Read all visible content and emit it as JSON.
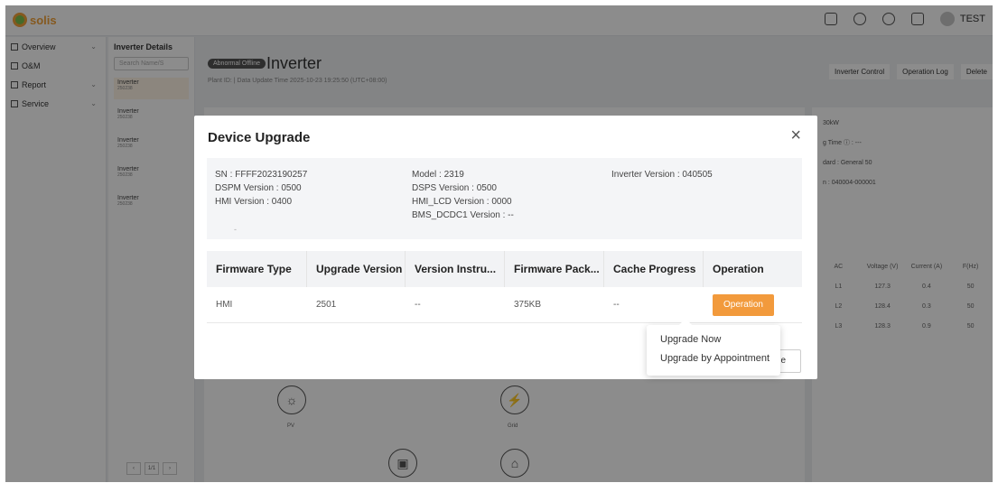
{
  "app": {
    "logo": "solis",
    "user": "TEST"
  },
  "sidebar": {
    "items": [
      {
        "label": "Overview",
        "icon": "grid-icon"
      },
      {
        "label": "O&M",
        "icon": "tools-icon"
      },
      {
        "label": "Report",
        "icon": "report-icon"
      },
      {
        "label": "Service",
        "icon": "service-icon"
      }
    ]
  },
  "inverter_list": {
    "title": "Inverter Details",
    "search_placeholder": "Search Name/S",
    "items": [
      {
        "name": "Inverter",
        "sn": "250238"
      },
      {
        "name": "Inverter",
        "sn": "250238"
      },
      {
        "name": "Inverter",
        "sn": "250238"
      },
      {
        "name": "Inverter",
        "sn": "250238"
      },
      {
        "name": "Inverter",
        "sn": "250238"
      }
    ],
    "pager": "1/1"
  },
  "main": {
    "status_pill": "Abnormal Offline",
    "title": "Inverter",
    "plant_id": "Plant ID:        | Data Update Time 2025-10-23 19:25:50 (UTC+08:00)",
    "actions": [
      "Inverter Control",
      "Operation Log",
      "Delete"
    ],
    "right_info": [
      "30kW",
      "g Time ⓘ : ---",
      "dard : General 50",
      "n : 040004-000001"
    ],
    "voltage_table": {
      "headers": [
        "AC",
        "Voltage (V)",
        "Current (A)",
        "F(Hz)"
      ],
      "rows": [
        [
          "L1",
          "127.3",
          "0.4",
          "50"
        ],
        [
          "L2",
          "128.4",
          "0.3",
          "50"
        ],
        [
          "L3",
          "128.3",
          "0.9",
          "50"
        ]
      ]
    },
    "diagram_labels": [
      "PV",
      "Grid"
    ]
  },
  "modal": {
    "title": "Device Upgrade",
    "close": "×",
    "info": {
      "col1": [
        "SN : FFFF2023190257",
        "DSPM Version : 0500",
        "HMI Version : 0400"
      ],
      "col2": [
        "Model : 2319",
        "DSPS Version : 0500",
        "HMI_LCD Version : 0000",
        "BMS_DCDC1 Version : --"
      ],
      "col3": [
        "Inverter Version : 040505"
      ],
      "extra": "-"
    },
    "table": {
      "headers": [
        "Firmware Type",
        "Upgrade Version",
        "Version Instru...",
        "Firmware Pack...",
        "Cache Progress",
        "Operation"
      ],
      "rows": [
        {
          "type": "HMI",
          "version": "2501",
          "instruction": "--",
          "package": "375KB",
          "cache": "--",
          "operation": "Operation"
        }
      ]
    },
    "bg_button": "de",
    "dropdown": [
      "Upgrade Now",
      "Upgrade by Appointment"
    ]
  },
  "colors": {
    "accent": "#f29a3c",
    "overlay": "rgba(0,0,0,0.45)"
  }
}
